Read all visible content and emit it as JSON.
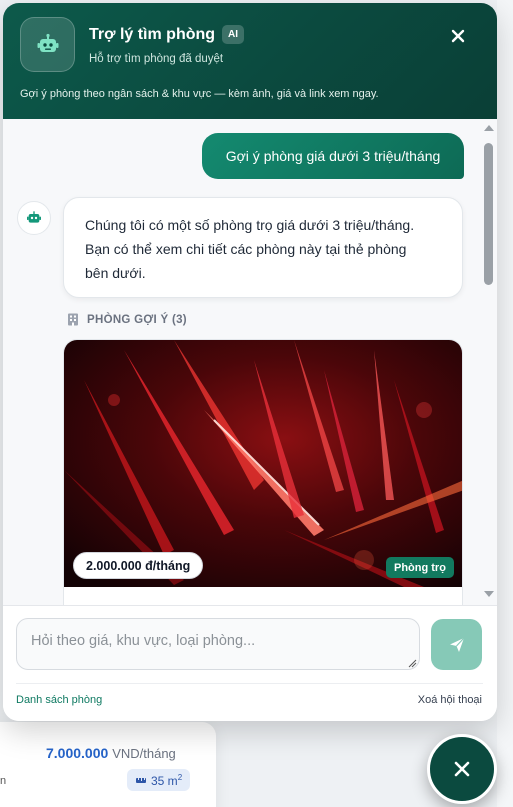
{
  "header": {
    "title": "Trợ lý tìm phòng",
    "ai_badge": "AI",
    "subtitle": "Hỗ trợ tìm phòng đã duyệt",
    "tagline": "Gợi ý phòng theo ngân sách & khu vực — kèm ảnh, giá và link xem ngay."
  },
  "messages": {
    "user_text": "Gợi ý phòng giá dưới 3 triệu/tháng",
    "bot_lines": [
      "Chúng tôi có một số phòng trọ giá dưới 3 triệu/tháng.",
      "Bạn có thể xem chi tiết các phòng này tại thẻ phòng",
      "bên dưới."
    ]
  },
  "rooms": {
    "heading": "PHÒNG GỢI Ý (3)",
    "first": {
      "price": "2.000.000 đ/tháng",
      "type": "Phòng trọ"
    }
  },
  "composer": {
    "placeholder": "Hỏi theo giá, khu vực, loại phòng...",
    "link_list": "Danh sách phòng",
    "link_clear": "Xoá hội thoại"
  },
  "background_card": {
    "price_value": "7.000.000",
    "price_unit": "VND/tháng",
    "area": "35 m",
    "area_sup": "2",
    "left_fragment": "n"
  },
  "colors": {
    "brand_dark": "#0b4a3f",
    "brand": "#127a5f",
    "send_disabled": "#86c9b7",
    "link": "#0f7a62",
    "bg_price": "#2563c9"
  },
  "icons": {
    "header_avatar": "robot-icon",
    "close": "close-icon",
    "bot_mini": "robot-icon",
    "rooms_heading": "building-icon",
    "send": "send-icon",
    "area": "ruler-icon",
    "fab": "close-icon"
  }
}
